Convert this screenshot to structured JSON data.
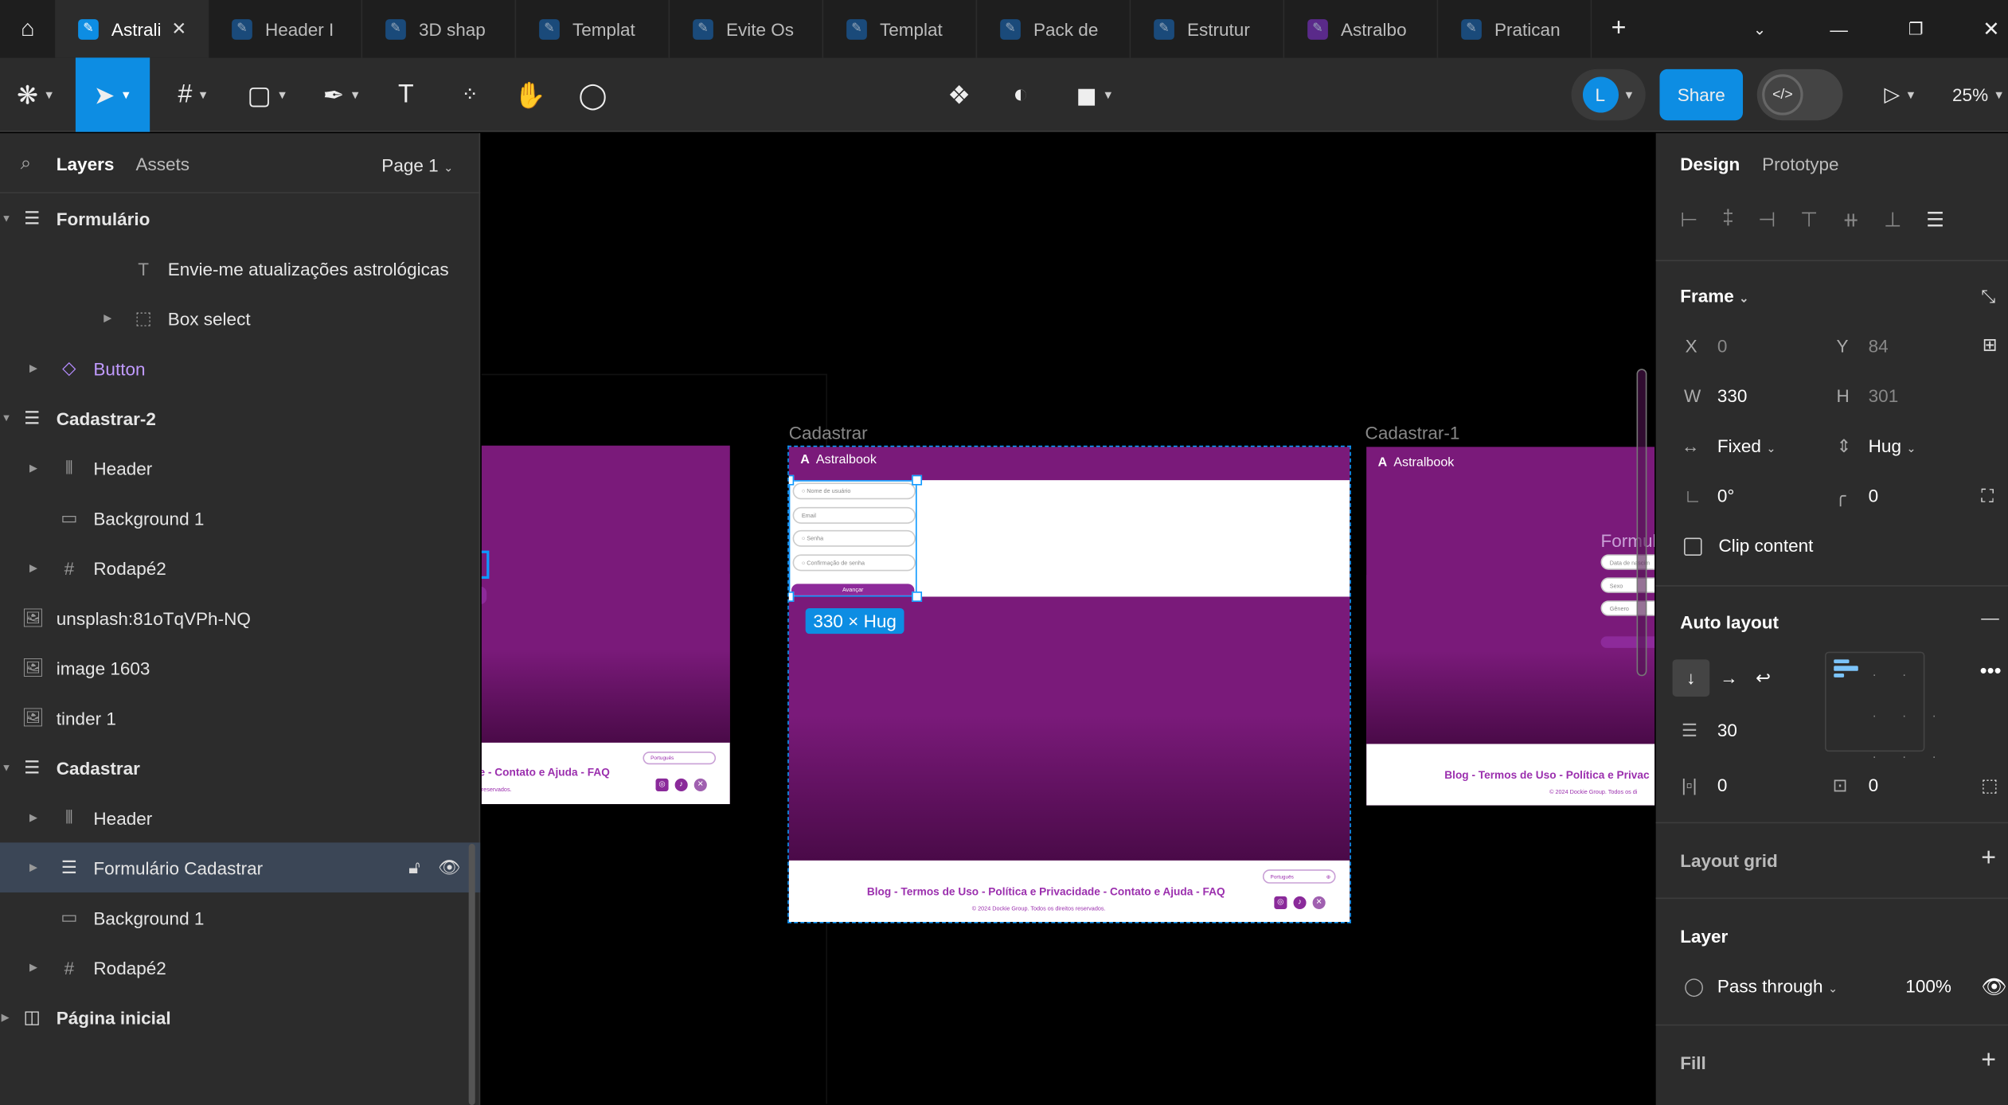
{
  "tabs": [
    {
      "label": "Astrali",
      "active": true,
      "color": "#0d8de3"
    },
    {
      "label": "Header I",
      "color": "#1a4a7a"
    },
    {
      "label": "3D shap",
      "color": "#1a4a7a"
    },
    {
      "label": "Templat",
      "color": "#1a4a7a"
    },
    {
      "label": "Evite Os",
      "color": "#1a4a7a"
    },
    {
      "label": "Templat",
      "color": "#1a4a7a"
    },
    {
      "label": "Pack de",
      "color": "#1a4a7a"
    },
    {
      "label": "Estrutur",
      "color": "#1a4a7a"
    },
    {
      "label": "Astralbo",
      "color": "#5a2a8a"
    },
    {
      "label": "Pratican",
      "color": "#1a4a7a"
    }
  ],
  "toolbar": {
    "avatar_letter": "L",
    "share": "Share",
    "zoom": "25%"
  },
  "left": {
    "tab_layers": "Layers",
    "tab_assets": "Assets",
    "page": "Page 1",
    "layers": [
      {
        "label": "Formulário",
        "bold": true,
        "icon": "auto-layout-icon"
      },
      {
        "label": "Envie-me atualizações astrológicas",
        "icon": "text-icon"
      },
      {
        "label": "Box select",
        "icon": "frame-dashed-icon"
      },
      {
        "label": "Button",
        "icon": "component-instance-icon"
      },
      {
        "label": "Cadastrar-2",
        "bold": true,
        "icon": "auto-layout-icon"
      },
      {
        "label": "Header",
        "icon": "auto-layout-horizontal-icon"
      },
      {
        "label": "Background 1",
        "icon": "rectangle-icon"
      },
      {
        "label": "Rodapé2",
        "icon": "frame-icon"
      },
      {
        "label": "unsplash:81oTqVPh-NQ",
        "icon": "image-icon"
      },
      {
        "label": "image 1603",
        "icon": "image-icon"
      },
      {
        "label": "tinder 1",
        "icon": "image-icon"
      },
      {
        "label": "Cadastrar",
        "bold": true,
        "icon": "auto-layout-icon"
      },
      {
        "label": "Header",
        "icon": "auto-layout-horizontal-icon"
      },
      {
        "label": "Formulário Cadastrar",
        "icon": "auto-layout-icon",
        "selected": true
      },
      {
        "label": "Background 1",
        "icon": "rectangle-icon"
      },
      {
        "label": "Rodapé2",
        "icon": "frame-icon"
      },
      {
        "label": "Página inicial",
        "bold": true,
        "icon": "page-frame-icon"
      }
    ]
  },
  "canvas": {
    "frame_cadastrar": "Cadastrar",
    "frame_cadastrar1": "Cadastrar-1",
    "brand": "Astralbook",
    "fields": [
      "Nome de usuário",
      "Email",
      "Senha",
      "Confirmação de senha"
    ],
    "button": "Avançar",
    "size_badge": "330 × Hug",
    "footer_links": "Blog - Termos de Uso - Política e Privacidade - Contato e Ajuda - FAQ",
    "footer_links_left": "e - Contato e Ajuda - FAQ",
    "footer_links_right": "Blog - Termos de Uso - Política e Privac",
    "copyright": "© 2024 Dockie Group.  Todos os direitos reservados.",
    "copyright_right": "© 2024 Dockie Group.  Todos os di",
    "copyright_left": "reservados.",
    "language": "Português",
    "form1_title": "Formul",
    "form1_fields": [
      "Data de nascim",
      "Sexo",
      "Gênero"
    ],
    "brand_color": "#7a1a7a",
    "accent": "#9b2fae"
  },
  "right": {
    "tab_design": "Design",
    "tab_prototype": "Prototype",
    "frame": "Frame",
    "x": "0",
    "y": "84",
    "w": "330",
    "h": "301",
    "w_mode": "Fixed",
    "h_mode": "Hug",
    "rotation": "0°",
    "radius": "0",
    "clip": "Clip content",
    "auto_layout": "Auto layout",
    "gap": "30",
    "pad_h": "0",
    "pad_v": "0",
    "layout_grid": "Layout grid",
    "layer": "Layer",
    "blend": "Pass through",
    "opacity": "100%",
    "fill": "Fill"
  }
}
